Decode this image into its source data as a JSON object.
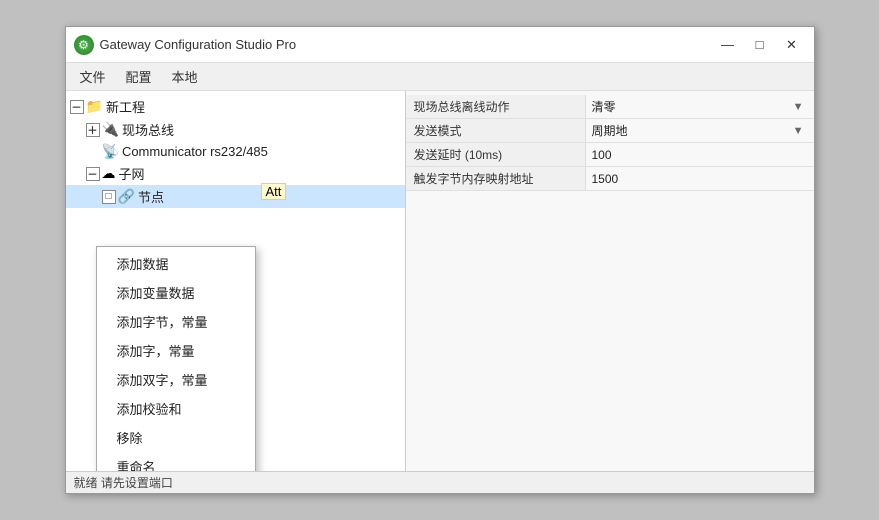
{
  "window": {
    "title": "Gateway Configuration Studio Pro",
    "icon": "gear-icon"
  },
  "titlebar": {
    "minimize": "—",
    "maximize": "□",
    "close": "✕"
  },
  "menubar": {
    "items": [
      "文件",
      "配置",
      "本地"
    ]
  },
  "tree": {
    "nodes": [
      {
        "id": 0,
        "indent": 0,
        "expander": "－",
        "icon": "📁",
        "label": "新工程",
        "selected": false
      },
      {
        "id": 1,
        "indent": 1,
        "expander": "＋",
        "icon": "🔌",
        "label": "现场总线",
        "selected": false
      },
      {
        "id": 2,
        "indent": 1,
        "expander": null,
        "icon": "📡",
        "label": "Communicator rs232/485",
        "selected": false
      },
      {
        "id": 3,
        "indent": 1,
        "expander": "－",
        "icon": "☁",
        "label": "子网",
        "selected": false
      },
      {
        "id": 4,
        "indent": 2,
        "expander": "□",
        "icon": "🔗",
        "label": "节点",
        "selected": true
      }
    ],
    "att_label": "Att"
  },
  "properties": {
    "rows": [
      {
        "label": "现场总线离线动作",
        "value": "清零",
        "hasDropdown": true
      },
      {
        "label": "发送模式",
        "value": "周期地",
        "hasDropdown": true
      },
      {
        "label": "发送延时 (10ms)",
        "value": "100",
        "hasDropdown": false
      },
      {
        "label": "触发字节内存映射地址",
        "value": "1500",
        "hasDropdown": false
      }
    ]
  },
  "context_menu": {
    "items": [
      "添加数据",
      "添加变量数据",
      "添加字节，常量",
      "添加字，常量",
      "添加双字，常量",
      "添加校验和",
      "移除",
      "重命名"
    ]
  },
  "statusbar": {
    "text": "就绪 请先设置端口"
  }
}
